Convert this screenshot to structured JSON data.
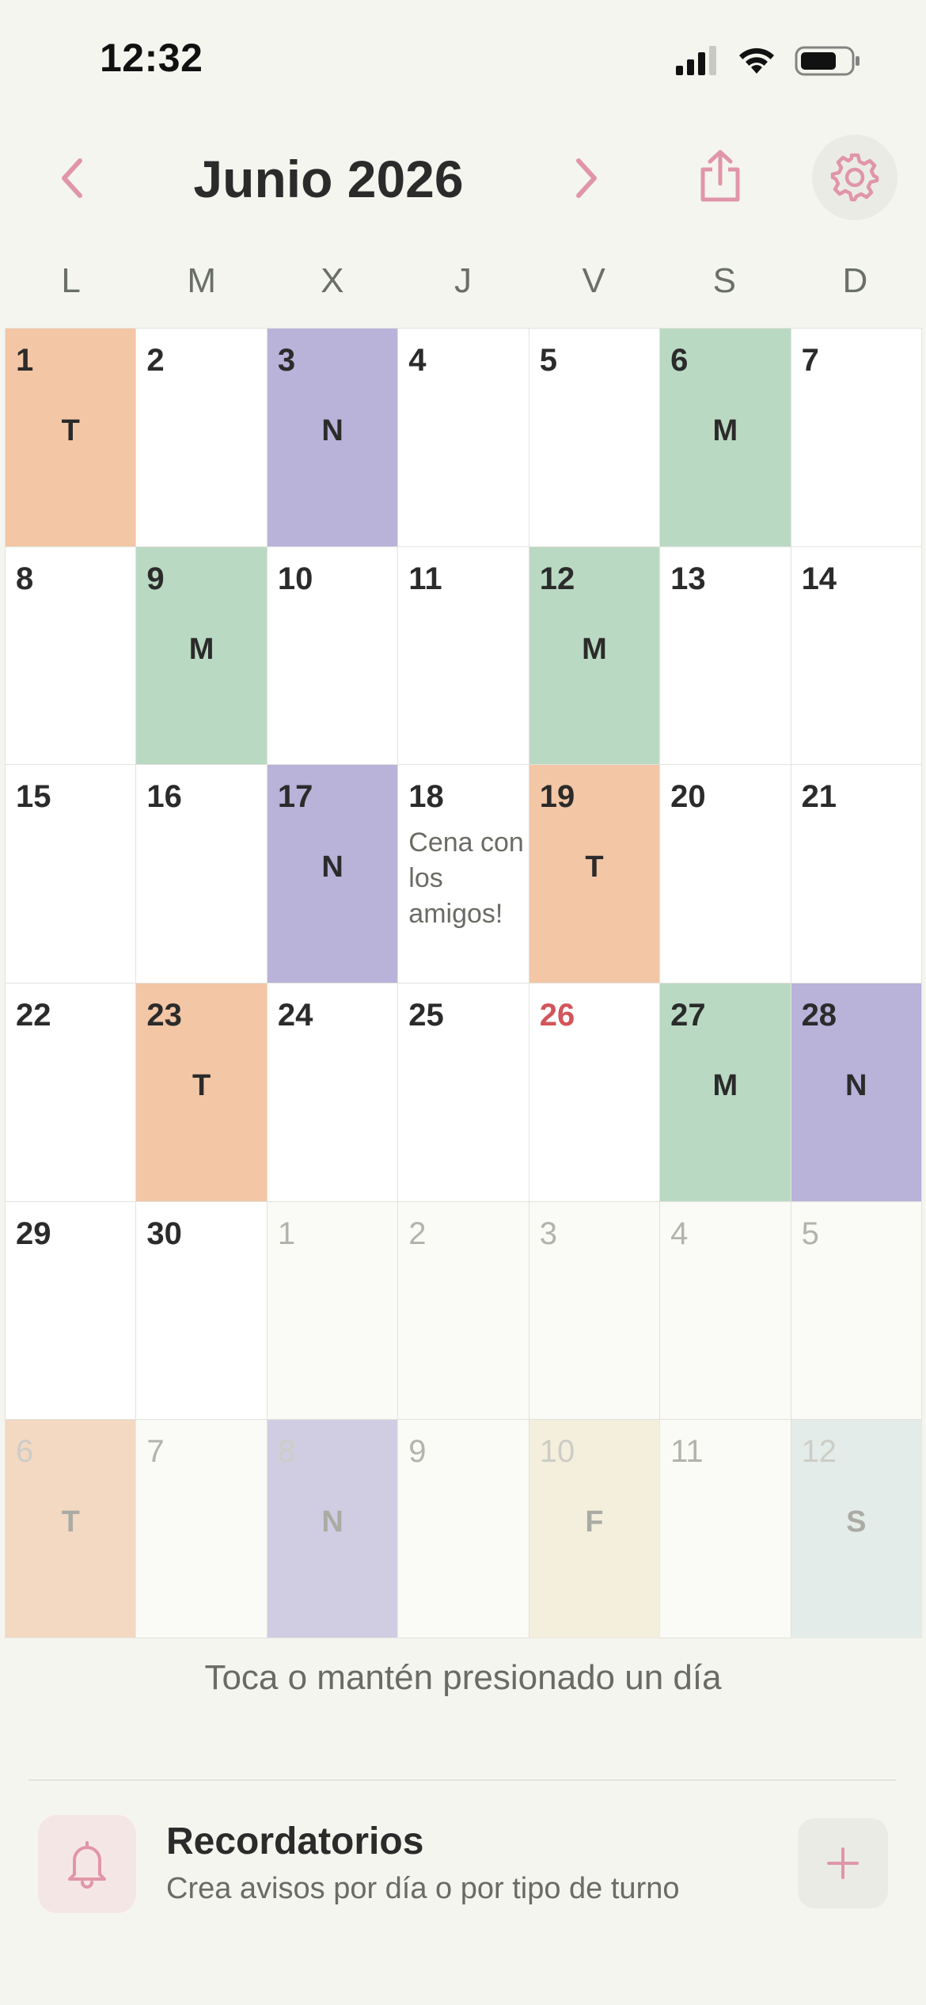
{
  "status_bar": {
    "time": "12:32"
  },
  "header": {
    "title": "Junio 2026",
    "prev_icon": "chevron-left-icon",
    "next_icon": "chevron-right-icon",
    "share_icon": "share-icon",
    "settings_icon": "gear-icon"
  },
  "weekdays": [
    "L",
    "M",
    "X",
    "J",
    "V",
    "S",
    "D"
  ],
  "colors": {
    "T": "#f3c6a5",
    "N": "#b9b2d9",
    "M": "#bad9c3",
    "F": "#f2ecd0",
    "S": "#d8e7e5",
    "accent": "#e096a6",
    "today": "#d2555a"
  },
  "days": [
    {
      "day": "1",
      "shift": "T"
    },
    {
      "day": "2"
    },
    {
      "day": "3",
      "shift": "N"
    },
    {
      "day": "4"
    },
    {
      "day": "5"
    },
    {
      "day": "6",
      "shift": "M"
    },
    {
      "day": "7"
    },
    {
      "day": "8"
    },
    {
      "day": "9",
      "shift": "M"
    },
    {
      "day": "10"
    },
    {
      "day": "11"
    },
    {
      "day": "12",
      "shift": "M"
    },
    {
      "day": "13"
    },
    {
      "day": "14"
    },
    {
      "day": "15"
    },
    {
      "day": "16"
    },
    {
      "day": "17",
      "shift": "N"
    },
    {
      "day": "18",
      "note": "Cena con los amigos!"
    },
    {
      "day": "19",
      "shift": "T"
    },
    {
      "day": "20"
    },
    {
      "day": "21"
    },
    {
      "day": "22"
    },
    {
      "day": "23",
      "shift": "T"
    },
    {
      "day": "24"
    },
    {
      "day": "25"
    },
    {
      "day": "26",
      "today": true
    },
    {
      "day": "27",
      "shift": "M"
    },
    {
      "day": "28",
      "shift": "N"
    },
    {
      "day": "29"
    },
    {
      "day": "30"
    },
    {
      "day": "1",
      "outside": true
    },
    {
      "day": "2",
      "outside": true
    },
    {
      "day": "3",
      "outside": true
    },
    {
      "day": "4",
      "outside": true
    },
    {
      "day": "5",
      "outside": true
    },
    {
      "day": "6",
      "shift": "T",
      "outside": true
    },
    {
      "day": "7",
      "outside": true
    },
    {
      "day": "8",
      "shift": "N",
      "outside": true
    },
    {
      "day": "9",
      "outside": true
    },
    {
      "day": "10",
      "shift": "F",
      "outside": true
    },
    {
      "day": "11",
      "outside": true
    },
    {
      "day": "12",
      "shift": "S",
      "outside": true
    }
  ],
  "hint": "Toca o mantén presionado un día",
  "reminders": {
    "title": "Recordatorios",
    "subtitle": "Crea avisos por día o por tipo de turno",
    "icon": "bell-icon",
    "add_icon": "plus-icon"
  }
}
